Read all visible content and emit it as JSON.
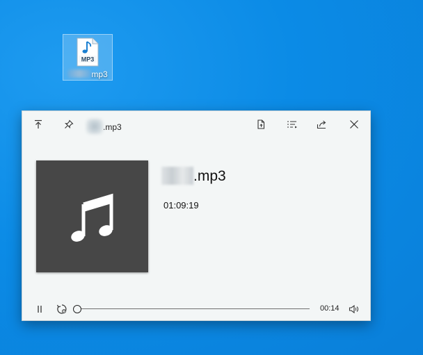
{
  "desktop_icon": {
    "file_badge": "MP3",
    "label_suffix": "mp3"
  },
  "player": {
    "title_suffix": ".mp3",
    "track": {
      "name_suffix": ".mp3",
      "duration": "01:09:19"
    },
    "playback": {
      "position": "00:14",
      "progress_fraction": 0.0034
    },
    "icons": {
      "pin_top": "keep-on-top-icon",
      "pin": "pin-icon",
      "open_file": "open-file-icon",
      "playlist": "playlist-icon",
      "share": "share-icon",
      "close": "close-icon",
      "pause": "pause-icon",
      "replay": "replay-icon",
      "volume": "volume-icon"
    },
    "colors": {
      "album_bg": "#474747",
      "window_bg": "#f3f6f6",
      "desktop": "#0b8be6"
    }
  }
}
